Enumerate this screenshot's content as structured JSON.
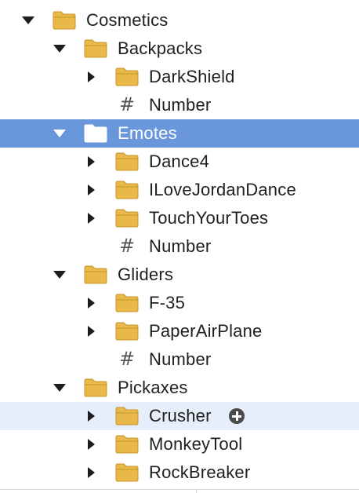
{
  "colors": {
    "folder_fill": "#e8b84b",
    "folder_stroke": "#c9962a",
    "selected_bg": "#6a97dc",
    "hover_bg": "#e6eefb",
    "selected_folder": "#ffffff"
  },
  "tree": {
    "cosmetics": "Cosmetics",
    "backpacks": "Backpacks",
    "darkshield": "DarkShield",
    "backpacks_number": "Number",
    "emotes": "Emotes",
    "dance4": "Dance4",
    "ilovejordandance": "ILoveJordanDance",
    "touchyourtoes": "TouchYourToes",
    "emotes_number": "Number",
    "gliders": "Gliders",
    "f35": "F-35",
    "paperairplane": "PaperAirPlane",
    "gliders_number": "Number",
    "pickaxes": "Pickaxes",
    "crusher": "Crusher",
    "monkeytool": "MonkeyTool",
    "rockbreaker": "RockBreaker"
  },
  "icons": {
    "folder": "folder-icon",
    "number": "number-value-icon",
    "add": "add-object-icon"
  }
}
